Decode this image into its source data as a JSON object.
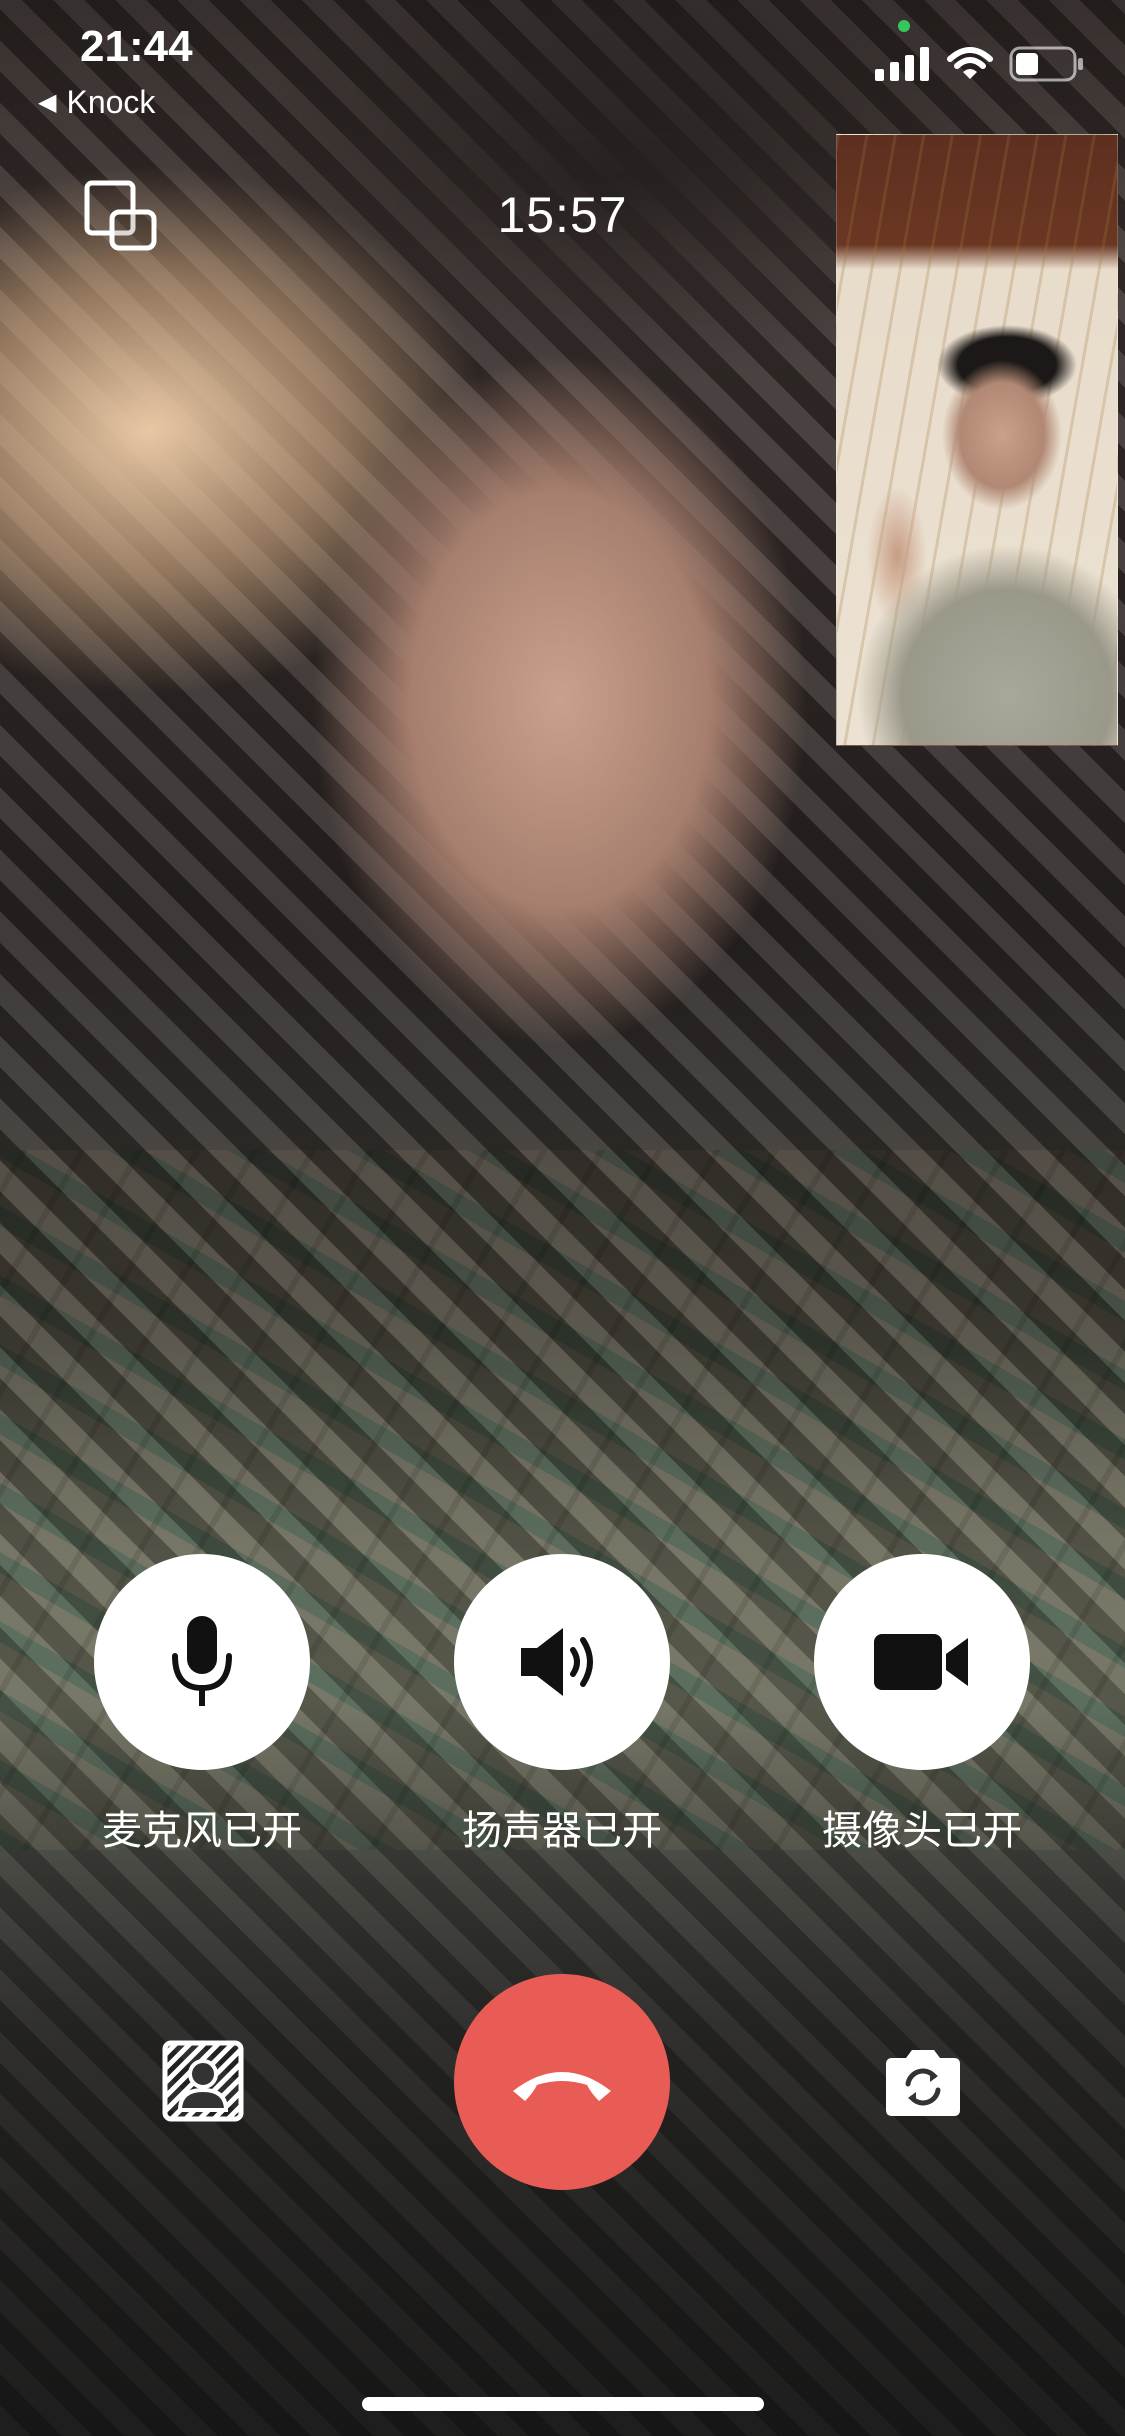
{
  "status_bar": {
    "time": "21:44",
    "back_app": "Knock",
    "icons": [
      "cellular-signal-icon",
      "wifi-icon",
      "battery-icon"
    ]
  },
  "call": {
    "timer": "15:57"
  },
  "controls": [
    {
      "id": "mic",
      "label": "麦克风已开",
      "icon": "microphone-icon"
    },
    {
      "id": "speaker",
      "label": "扬声器已开",
      "icon": "speaker-icon"
    },
    {
      "id": "camera",
      "label": "摄像头已开",
      "icon": "video-camera-icon"
    }
  ],
  "bottom_actions": {
    "left_icon": "background-blur-icon",
    "center_icon": "hang-up-icon",
    "right_icon": "switch-camera-icon"
  },
  "colors": {
    "hangup": "#e85c55",
    "control_bg": "#ffffff",
    "status_dot": "#34c759"
  }
}
